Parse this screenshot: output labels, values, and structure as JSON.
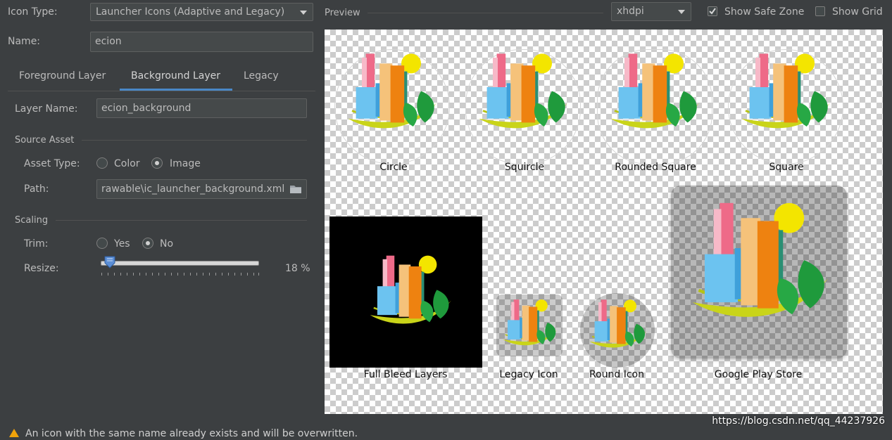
{
  "form": {
    "icon_type_label": "Icon Type:",
    "icon_type_value": "Launcher Icons (Adaptive and Legacy)",
    "name_label": "Name:",
    "name_value": "ecion"
  },
  "tabs": [
    {
      "label": "Foreground Layer"
    },
    {
      "label": "Background Layer"
    },
    {
      "label": "Legacy"
    }
  ],
  "layer": {
    "layer_name_label": "Layer Name:",
    "layer_name_value": "ecion_background",
    "source_asset_heading": "Source Asset",
    "asset_type_label": "Asset Type:",
    "asset_type_options": [
      "Color",
      "Image"
    ],
    "asset_type_selected": "Image",
    "path_label": "Path:",
    "path_value": "rawable\\ic_launcher_background.xml",
    "scaling_heading": "Scaling",
    "trim_label": "Trim:",
    "trim_options": [
      "Yes",
      "No"
    ],
    "trim_selected": "No",
    "resize_label": "Resize:",
    "resize_value": "18 %",
    "resize_fraction": 0.02
  },
  "preview": {
    "label": "Preview",
    "density": "xhdpi",
    "show_safe_zone_label": "Show Safe Zone",
    "show_safe_zone_checked": true,
    "show_grid_label": "Show Grid",
    "show_grid_checked": false,
    "tiles": [
      "Circle",
      "Squircle",
      "Rounded Square",
      "Square",
      "Full Bleed Layers",
      "Legacy Icon",
      "Round Icon",
      "Google Play Store"
    ]
  },
  "warning": {
    "text": "An icon with the same name already exists and will be overwritten."
  },
  "watermark": "https://blog.csdn.net/qq_44237926",
  "icons": {
    "folder": "folder-icon",
    "warning": "warning-icon",
    "dropdown": "chevron-down-icon"
  }
}
